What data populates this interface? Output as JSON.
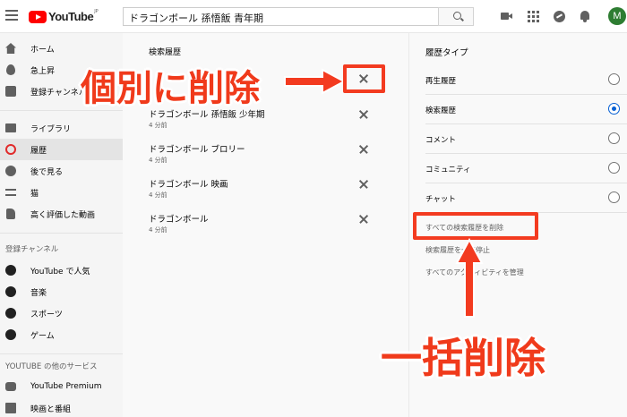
{
  "header": {
    "logo_text": "YouTube",
    "logo_region": "JP",
    "search_value": "ドラゴンボール 孫悟飯 青年期",
    "avatar_letter": "M"
  },
  "sidebar": {
    "main": [
      {
        "label": "ホーム",
        "icon": "home-icon"
      },
      {
        "label": "急上昇",
        "icon": "fire-icon"
      },
      {
        "label": "登録チャンネル",
        "icon": "subscriptions-icon"
      }
    ],
    "library": [
      {
        "label": "ライブラリ",
        "icon": "folder-icon"
      },
      {
        "label": "履歴",
        "icon": "history-icon",
        "active": true
      },
      {
        "label": "後で見る",
        "icon": "clock-icon"
      },
      {
        "label": "猫",
        "icon": "playlist-icon"
      },
      {
        "label": "高く評価した動画",
        "icon": "thumbs-up-icon"
      }
    ],
    "subscriptions_heading": "登録チャンネル",
    "subscriptions": [
      {
        "label": "YouTube で人気",
        "icon": "popular-icon"
      },
      {
        "label": "音楽",
        "icon": "music-icon"
      },
      {
        "label": "スポーツ",
        "icon": "sports-icon"
      },
      {
        "label": "ゲーム",
        "icon": "gaming-icon"
      }
    ],
    "services_heading": "YOUTUBE の他のサービス",
    "services": [
      {
        "label": "YouTube Premium",
        "icon": "premium-icon"
      },
      {
        "label": "映画と番組",
        "icon": "film-icon"
      }
    ]
  },
  "history": {
    "title": "検索履歴",
    "entries": [
      {
        "query": "ドラゴンボール 孫悟飯 少年期",
        "time": "4 分前"
      },
      {
        "query": "ドラゴンボール ブロリー",
        "time": "4 分前"
      },
      {
        "query": "ドラゴンボール 映画",
        "time": "4 分前"
      },
      {
        "query": "ドラゴンボール",
        "time": "4 分前"
      }
    ]
  },
  "history_type": {
    "title": "履歴タイプ",
    "options": [
      {
        "label": "再生履歴",
        "selected": false
      },
      {
        "label": "検索履歴",
        "selected": true
      },
      {
        "label": "コメント",
        "selected": false
      },
      {
        "label": "コミュニティ",
        "selected": false
      },
      {
        "label": "チャット",
        "selected": false
      }
    ],
    "clear_all": "すべての検索履歴を削除",
    "pause": "検索履歴を一時停止",
    "manage": "すべてのアクティビティを管理"
  },
  "annotations": {
    "individual_delete": "個別に削除",
    "bulk_delete": "一括削除",
    "color": "#f33b20"
  }
}
